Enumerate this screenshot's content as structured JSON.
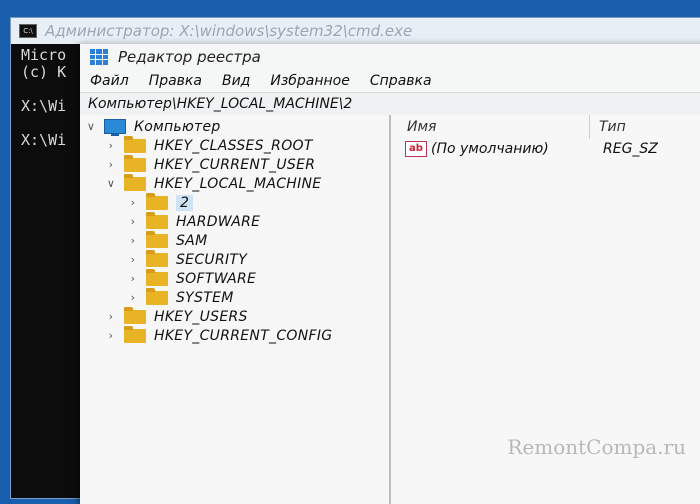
{
  "cmd": {
    "title": "Администратор: X:\\windows\\system32\\cmd.exe",
    "lines": [
      "Micro",
      "(c) K",
      "",
      "X:\\Wi",
      "",
      "X:\\Wi"
    ]
  },
  "regedit": {
    "title": "Редактор реестра",
    "menu": [
      "Файл",
      "Правка",
      "Вид",
      "Избранное",
      "Справка"
    ],
    "address": "Компьютер\\HKEY_LOCAL_MACHINE\\2",
    "tree": {
      "root": "Компьютер",
      "hives": [
        "HKEY_CLASSES_ROOT",
        "HKEY_CURRENT_USER",
        "HKEY_LOCAL_MACHINE"
      ],
      "hklm_children": [
        "2",
        "HARDWARE",
        "SAM",
        "SECURITY",
        "SOFTWARE",
        "SYSTEM"
      ],
      "more_hives": [
        "HKEY_USERS",
        "HKEY_CURRENT_CONFIG"
      ]
    },
    "list": {
      "col_name": "Имя",
      "col_type": "Тип",
      "rows": [
        {
          "name": "(По умолчанию)",
          "type": "REG_SZ"
        }
      ]
    }
  },
  "watermark": "RemontCompa.ru",
  "colors": {
    "desktop": "#1a5fae",
    "folder": "#e8b325",
    "selection": "#cfe3f6"
  },
  "icons": {
    "folder": "folder-icon",
    "computer": "computer-icon",
    "string_value": "ab-string-icon"
  }
}
